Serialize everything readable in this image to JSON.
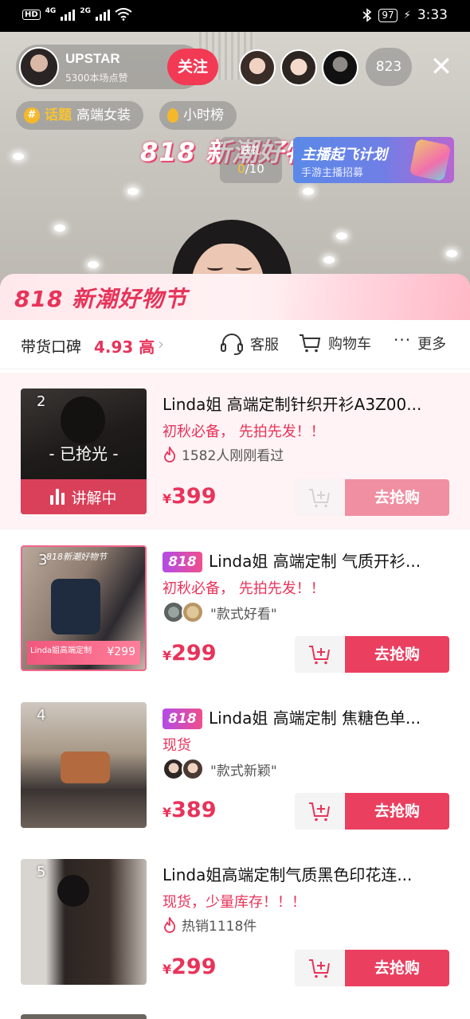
{
  "status_bar": {
    "left_label": "HD",
    "net1": "4G",
    "net2": "2G",
    "battery": "97",
    "time": "3:33"
  },
  "live": {
    "host_name": "UPSTAR",
    "host_likes": "5300本场点赞",
    "follow_label": "关注",
    "viewer_count": "823",
    "close_symbol": "✕",
    "tags": [
      {
        "topic_label": "话题",
        "text": "高端女装"
      },
      {
        "text": "小时榜"
      }
    ],
    "banner_text": "818 新潮好物节",
    "task": {
      "title": "跌礼",
      "progress": "0",
      "total": "/10"
    },
    "recruit": {
      "title": "主播起飞计划",
      "subtitle": "手游主播招募"
    }
  },
  "panel": {
    "title": "818 新潮好物节",
    "reputation_label": "带货口碑",
    "reputation_score": "4.93 高",
    "actions": {
      "service": "客服",
      "cart": "购物车",
      "more": "更多"
    }
  },
  "products": [
    {
      "rank": "2",
      "title": "Linda姐 高端定制针织开衫A3Z00...",
      "promo": "初秋必备， 先拍先发！！",
      "meta_text": "1582人刚刚看过",
      "currency": "¥",
      "price": "399",
      "buy_label": "去抢购",
      "soldout_label": "- 已抢光 -",
      "explaining_label": "讲解中"
    },
    {
      "rank": "3",
      "badge": "818",
      "title": "Linda姐 高端定制 气质开衫...",
      "promo": "初秋必备， 先拍先发！！",
      "meta_text": "\"款式好看\"",
      "currency": "¥",
      "price": "299",
      "buy_label": "去抢购",
      "thumb_top": "818新潮好物节",
      "thumb_badge": "Linda姐高端定制",
      "thumb_price": "¥299"
    },
    {
      "rank": "4",
      "badge": "818",
      "title": "Linda姐 高端定制 焦糖色单...",
      "promo": "现货",
      "meta_text": "\"款式新颖\"",
      "currency": "¥",
      "price": "389",
      "buy_label": "去抢购"
    },
    {
      "rank": "5",
      "title": "Linda姐高端定制气质黑色印花连...",
      "promo": "现货，少量库存！！！",
      "meta_text": "热销1118件",
      "currency": "¥",
      "price": "299",
      "buy_label": "去抢购"
    }
  ]
}
